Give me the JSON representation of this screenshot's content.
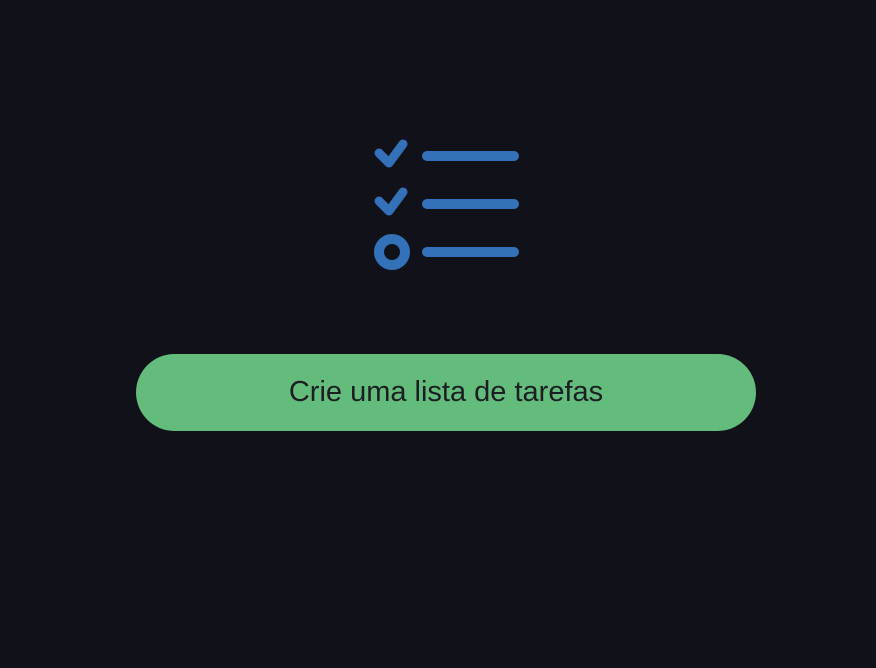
{
  "illustration": {
    "icon": "checklist-icon",
    "color": "#3372b8",
    "items": [
      {
        "state": "checked"
      },
      {
        "state": "checked"
      },
      {
        "state": "pending"
      }
    ]
  },
  "cta": {
    "label": "Crie uma lista de tarefas",
    "background": "#63bc7b",
    "text_color": "#1b1e22"
  },
  "theme": {
    "background": "#11111a"
  }
}
